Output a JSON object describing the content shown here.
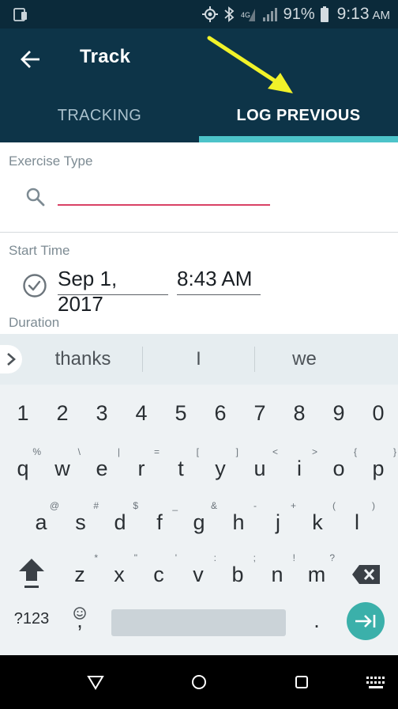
{
  "status_bar": {
    "battery": "91%",
    "time": "9:13",
    "ampm": "AM",
    "icons": [
      "screen-mirror-icon",
      "location-icon",
      "bluetooth-icon",
      "lte-icon",
      "signal-icon",
      "battery-icon"
    ]
  },
  "app_bar": {
    "title": "Track",
    "back_icon": "arrow-left-icon"
  },
  "tabs": [
    {
      "label": "TRACKING",
      "selected": false
    },
    {
      "label": "LOG PREVIOUS",
      "selected": true
    }
  ],
  "form": {
    "exercise_type": {
      "label": "Exercise Type",
      "value": "",
      "placeholder": ""
    },
    "start_time": {
      "label": "Start Time",
      "date": "Sep 1, 2017",
      "time": "8:43 AM"
    },
    "duration": {
      "label": "Duration"
    }
  },
  "keyboard": {
    "suggestions": [
      "thanks",
      "I",
      "we"
    ],
    "numbers": [
      "1",
      "2",
      "3",
      "4",
      "5",
      "6",
      "7",
      "8",
      "9",
      "0"
    ],
    "row1": [
      {
        "k": "q",
        "h": "%"
      },
      {
        "k": "w",
        "h": "\\"
      },
      {
        "k": "e",
        "h": "|"
      },
      {
        "k": "r",
        "h": "="
      },
      {
        "k": "t",
        "h": "["
      },
      {
        "k": "y",
        "h": "]"
      },
      {
        "k": "u",
        "h": "<"
      },
      {
        "k": "i",
        "h": ">"
      },
      {
        "k": "o",
        "h": "{"
      },
      {
        "k": "p",
        "h": "}"
      }
    ],
    "row2": [
      {
        "k": "a",
        "h": "@"
      },
      {
        "k": "s",
        "h": "#"
      },
      {
        "k": "d",
        "h": "$"
      },
      {
        "k": "f",
        "h": "_"
      },
      {
        "k": "g",
        "h": "&"
      },
      {
        "k": "h",
        "h": "-"
      },
      {
        "k": "j",
        "h": "+"
      },
      {
        "k": "k",
        "h": "("
      },
      {
        "k": "l",
        "h": ")"
      }
    ],
    "row3": [
      {
        "k": "z",
        "h": "*"
      },
      {
        "k": "x",
        "h": "\""
      },
      {
        "k": "c",
        "h": "'"
      },
      {
        "k": "v",
        "h": ":"
      },
      {
        "k": "b",
        "h": ";"
      },
      {
        "k": "n",
        "h": "!"
      },
      {
        "k": "m",
        "h": "?"
      }
    ],
    "symbols_label": "?123",
    "comma": ",",
    "period": "."
  },
  "colors": {
    "app_bar": "#0d3448",
    "tab_indicator": "#4cc3c9",
    "input_underline": "#d94165",
    "enter_key": "#3bb0aa",
    "annotation_arrow": "#f1f229"
  }
}
